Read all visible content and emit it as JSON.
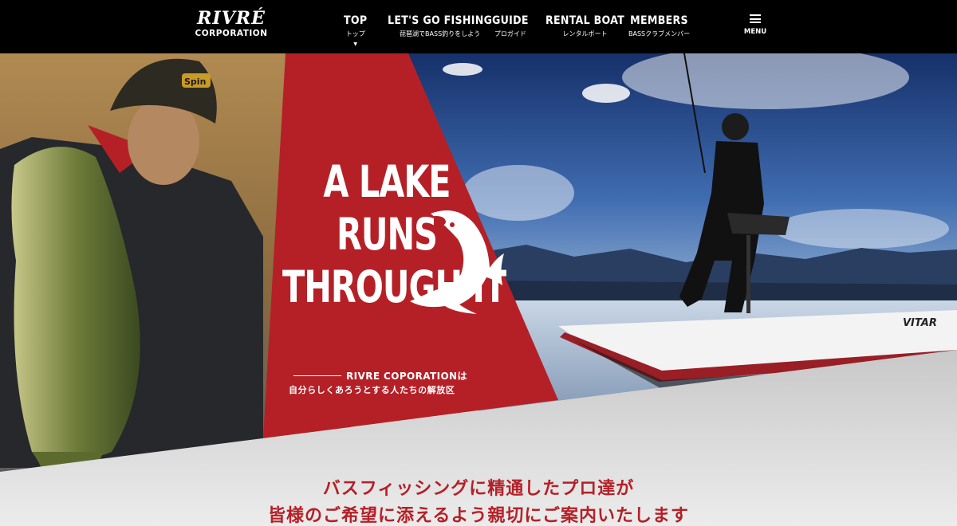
{
  "logo": {
    "main": "RIVRÉ",
    "sub": "CORPORATION"
  },
  "nav": [
    {
      "en": "TOP",
      "ja": "トップ",
      "active": true
    },
    {
      "en": "LET'S GO FISHING",
      "ja": "琵琶湖でBASS釣りをしよう"
    },
    {
      "en": "GUIDE",
      "ja": "プロガイド"
    },
    {
      "en": "RENTAL BOAT",
      "ja": "レンタルボート"
    },
    {
      "en": "MEMBERS",
      "ja": "BASSクラブメンバー"
    }
  ],
  "menu": {
    "label": "MENU",
    "icon": "hamburger-icon"
  },
  "hero": {
    "catch": [
      "A LAKE",
      "RUNS",
      "THROUGH IT"
    ],
    "tag_en": "RIVRE COPORATIONは",
    "tag_ja": "自分らしくあろうとする人たちの解放区",
    "fish_icon": "fish-icon",
    "cap_logo": "Spin",
    "boat_brand": "VITAR"
  },
  "intro": {
    "line1": "バスフィッシングに精通したプロ達が",
    "line2": "皆様のご希望に添えるよう親切にご案内いたします"
  },
  "colors": {
    "accent": "#b52027",
    "header_bg": "#000000",
    "page_bg": "#e6e6e6"
  }
}
